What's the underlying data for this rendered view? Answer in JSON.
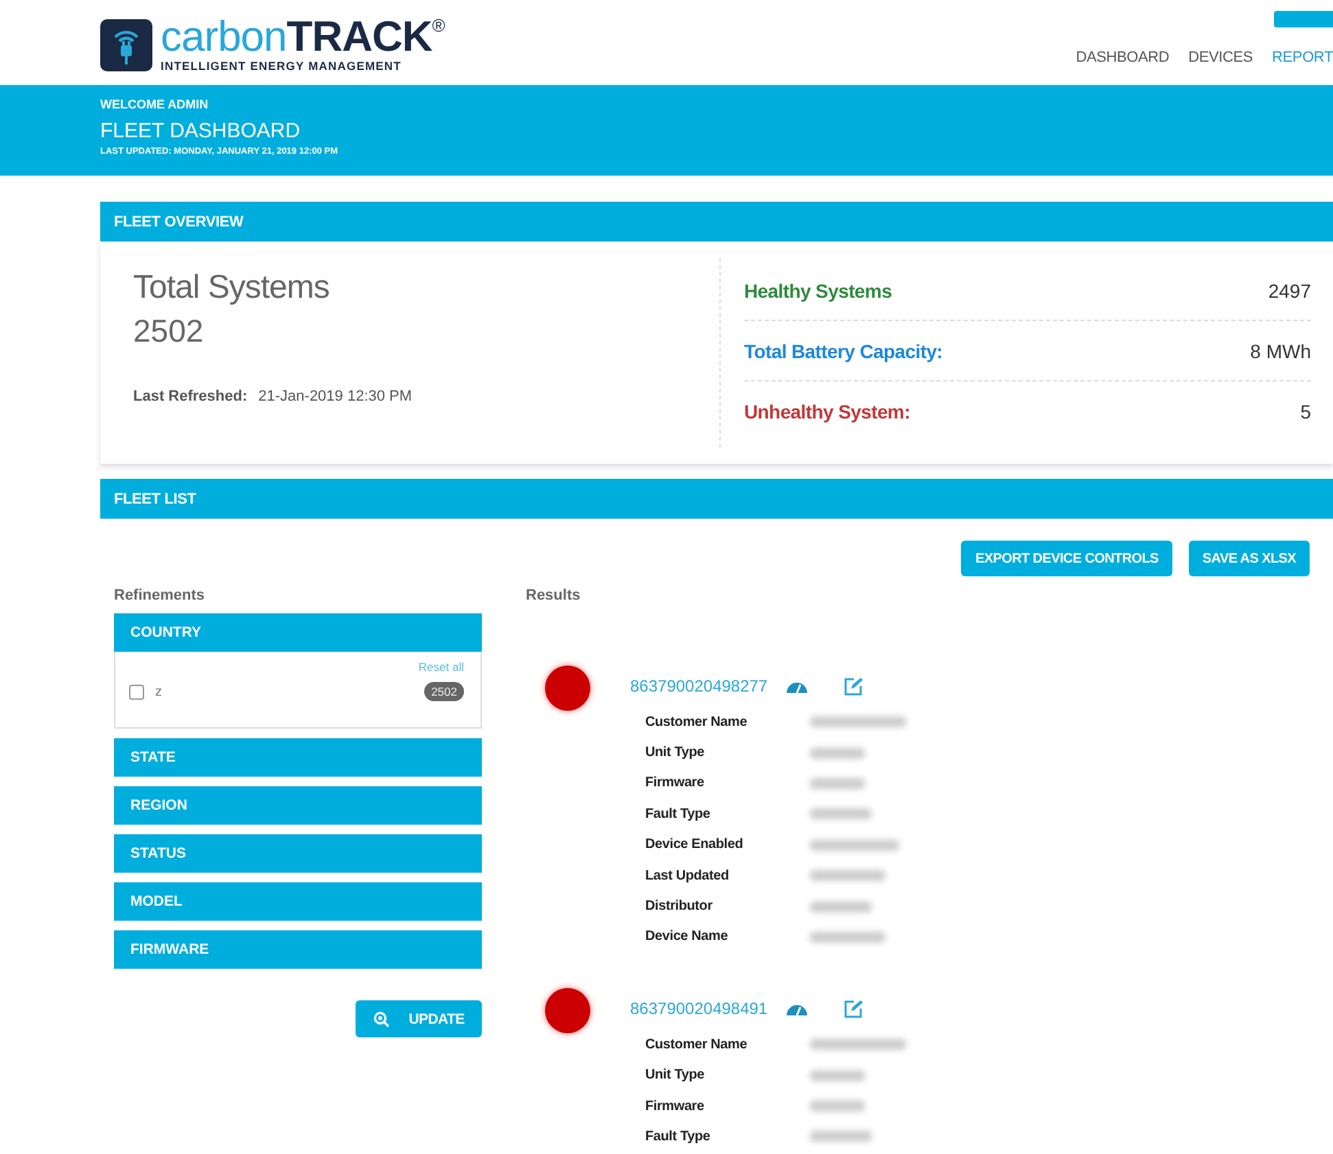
{
  "logo": {
    "brand": "carbon",
    "brand_bold": "TRACK",
    "mark": "®",
    "tagline": "INTELLIGENT ENERGY MANAGEMENT"
  },
  "nav": [
    {
      "label": "DASHBOARD",
      "selected": false
    },
    {
      "label": "DEVICES",
      "selected": false
    },
    {
      "label": "REPORT",
      "selected": true
    }
  ],
  "banner": {
    "welcome": "WELCOME ADMIN",
    "title": "FLEET DASHBOARD",
    "updated": "LAST UPDATED: MONDAY, JANUARY 21, 2019 12:00 PM"
  },
  "overview": {
    "header": "FLEET OVERVIEW",
    "total_label": "Total Systems",
    "total_value": "2502",
    "refreshed_label": "Last Refreshed:",
    "refreshed_value": "21-Jan-2019 12:30 PM",
    "metrics": [
      {
        "label": "Healthy Systems",
        "value": "2497",
        "color": "#2e8b3e"
      },
      {
        "label": "Total Battery Capacity:",
        "value": "8 MWh",
        "color": "#1e88d8"
      },
      {
        "label": "Unhealthy System:",
        "value": "5",
        "color": "#c0393b"
      }
    ]
  },
  "fleet_list": {
    "header": "FLEET LIST",
    "buttons": [
      "EXPORT DEVICE CONTROLS",
      "SAVE AS XLSX"
    ],
    "refinements_title": "Refinements",
    "filters": [
      {
        "label": "COUNTRY",
        "expanded": true,
        "reset": "Reset all",
        "options": [
          {
            "label": "z",
            "checked": false,
            "count": "2502"
          }
        ]
      },
      {
        "label": "STATE",
        "expanded": false
      },
      {
        "label": "REGION",
        "expanded": false
      },
      {
        "label": "STATUS",
        "expanded": false
      },
      {
        "label": "MODEL",
        "expanded": false
      },
      {
        "label": "FIRMWARE",
        "expanded": false
      }
    ],
    "update_button": "UPDATE",
    "results_title": "Results",
    "results": [
      {
        "id": "863790020498277",
        "color": "#cc0000",
        "fields": [
          "Customer Name",
          "Unit Type",
          "Firmware",
          "Fault Type",
          "Device Enabled",
          "Last Updated",
          "Distributor",
          "Device Name"
        ]
      },
      {
        "id": "863790020498491",
        "color": "#cc0000",
        "fields": [
          "Customer Name",
          "Unit Type",
          "Firmware",
          "Fault Type"
        ]
      }
    ]
  }
}
